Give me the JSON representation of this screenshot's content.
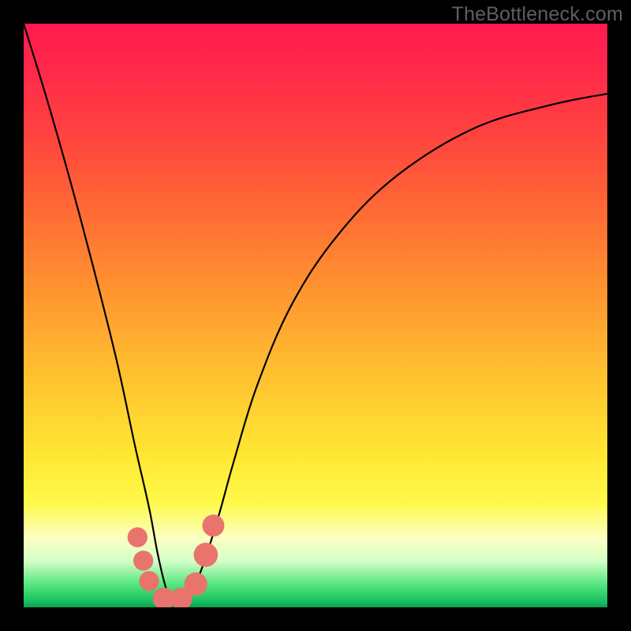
{
  "watermark": "TheBottleneck.com",
  "chart_data": {
    "type": "line",
    "title": "",
    "xlabel": "",
    "ylabel": "",
    "xlim": [
      0,
      100
    ],
    "ylim": [
      0,
      100
    ],
    "note": "Bottleneck-style V-shaped curve over a green-to-red vertical gradient. No axis ticks or numeric labels are visible; values are normalized 0–100 as estimated from pixel position.",
    "series": [
      {
        "name": "bottleneck-curve",
        "x": [
          0,
          4,
          8,
          12,
          16,
          19,
          21.5,
          23,
          24.5,
          26,
          27.5,
          29,
          31,
          33.5,
          36,
          40,
          46,
          54,
          64,
          77,
          90,
          100
        ],
        "y": [
          100,
          87,
          73,
          58,
          42,
          28,
          17,
          9,
          3,
          1,
          1,
          3,
          8,
          16,
          25,
          38,
          52,
          64,
          74,
          82,
          86,
          88
        ]
      }
    ],
    "markers": [
      {
        "x": 19.5,
        "y": 12,
        "r": 1.3
      },
      {
        "x": 20.5,
        "y": 8,
        "r": 1.3
      },
      {
        "x": 21.5,
        "y": 4.5,
        "r": 1.3
      },
      {
        "x": 24,
        "y": 1.5,
        "r": 1.5
      },
      {
        "x": 27,
        "y": 1.5,
        "r": 1.5
      },
      {
        "x": 29.5,
        "y": 4,
        "r": 1.6
      },
      {
        "x": 31.2,
        "y": 9,
        "r": 1.7
      },
      {
        "x": 32.5,
        "y": 14,
        "r": 1.5
      }
    ],
    "marker_color": "#e8746d",
    "curve_color": "#000000"
  }
}
